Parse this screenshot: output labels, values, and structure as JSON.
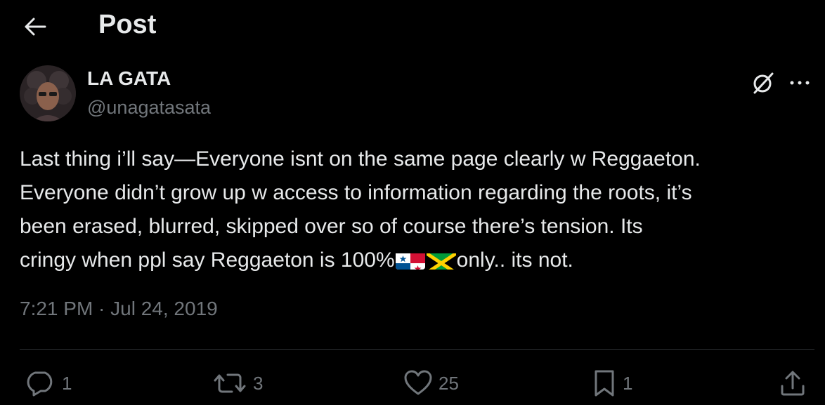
{
  "header": {
    "title": "Post",
    "back_icon": "arrow-left-icon"
  },
  "author": {
    "display_name": "LA GATA",
    "handle": "@unagatasata"
  },
  "tweet": {
    "line1": "Last thing i’ll say—Everyone isnt on the same page clearly w Reggaeton.",
    "line2": "Everyone didn’t grow up w access to information regarding the roots, it’s",
    "line3": "been erased, blurred, skipped over so of course there’s tension. Its",
    "line4_before": "cringy when ppl say Reggaeton is 100%",
    "line4_after": "only.. its not.",
    "flags": [
      "panama-flag",
      "jamaica-flag"
    ]
  },
  "timestamp": "7:21 PM · Jul 24, 2019",
  "actions": {
    "reply_count": "1",
    "repost_count": "3",
    "like_count": "25",
    "bookmark_count": "1"
  },
  "colors": {
    "background": "#000000",
    "text": "#e7e9ea",
    "muted": "#71767b",
    "divider": "#2f3336"
  }
}
